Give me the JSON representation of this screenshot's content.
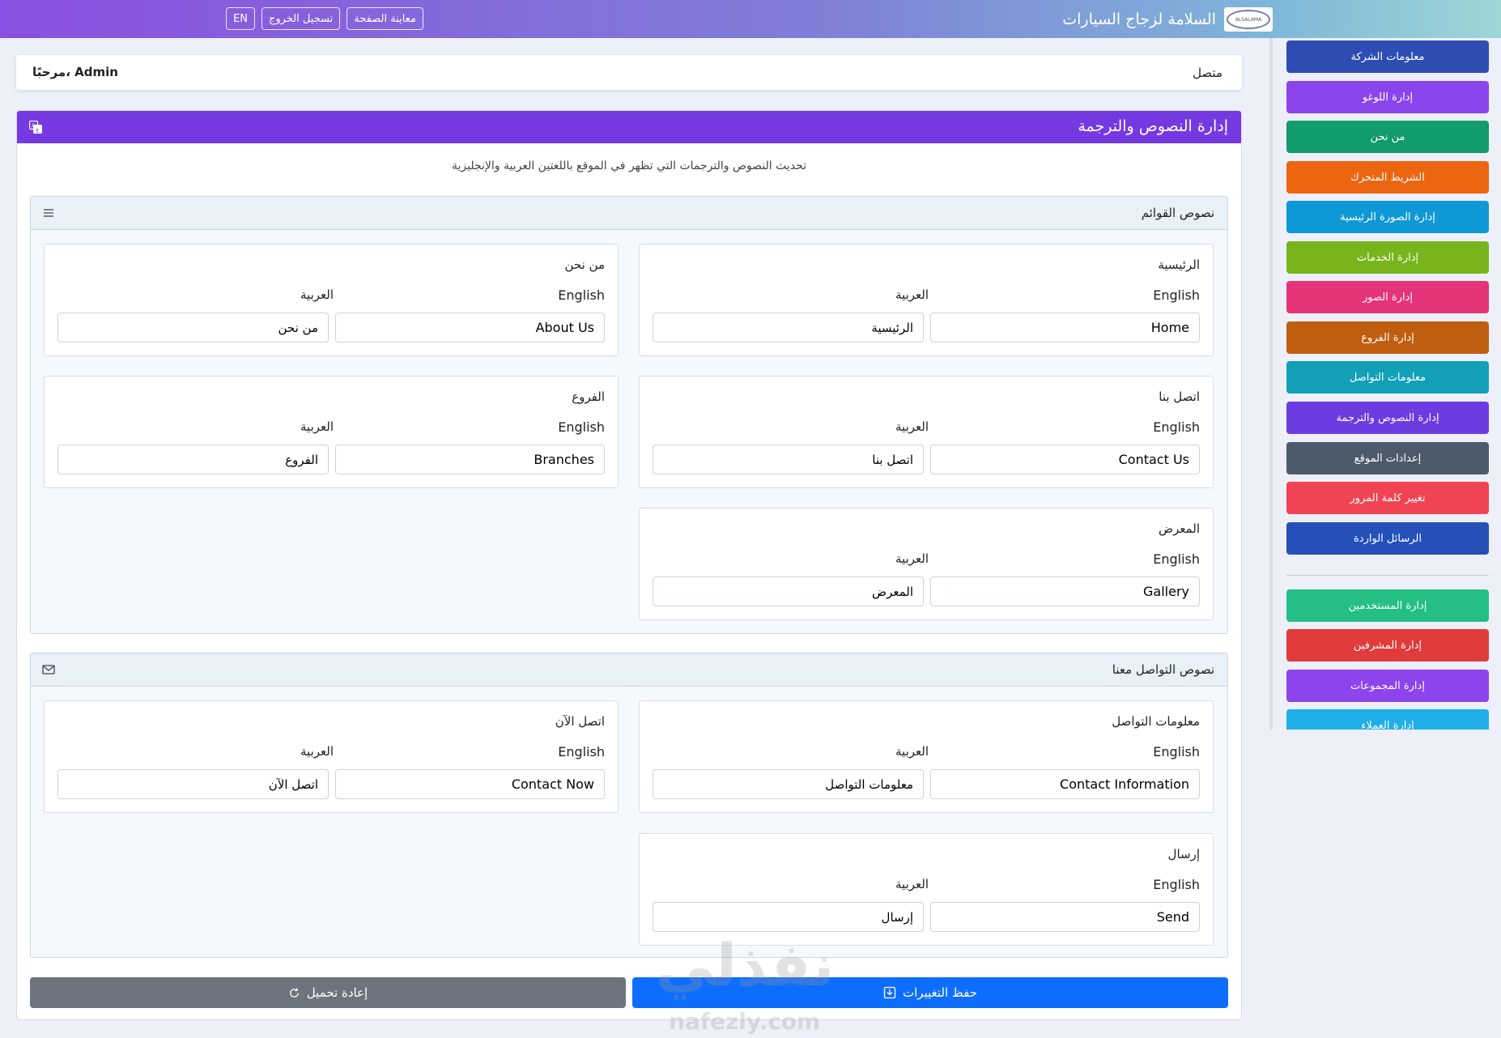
{
  "header": {
    "title": "السلامة لزجاج السيارات",
    "logo_text": "ALSALAMA",
    "buttons": {
      "preview": "معاينة الصفحة",
      "logout": "تسجيل الخروج",
      "lang": "EN"
    }
  },
  "welcome": {
    "status": "متصل",
    "greeting": "مرحبًا، Admin"
  },
  "panel": {
    "title": "إدارة النصوص والترجمة",
    "subtitle": "تحديث النصوص والترجمات التي تظهر في الموقع باللغتين العربية والإنجليزية",
    "labels": {
      "english": "English",
      "arabic": "العربية"
    },
    "sections": [
      {
        "title": "نصوص القوائم",
        "items": [
          {
            "title": "الرئيسية",
            "en": "Home",
            "ar": "الرئيسية"
          },
          {
            "title": "من نحن",
            "en": "About Us",
            "ar": "من نحن"
          },
          {
            "title": "اتصل بنا",
            "en": "Contact Us",
            "ar": "اتصل بنا"
          },
          {
            "title": "الفروع",
            "en": "Branches",
            "ar": "الفروع"
          },
          {
            "title": "المعرض",
            "en": "Gallery",
            "ar": "المعرض"
          }
        ]
      },
      {
        "title": "نصوص التواصل معنا",
        "items": [
          {
            "title": "معلومات التواصل",
            "en": "Contact Information",
            "ar": "معلومات التواصل"
          },
          {
            "title": "اتصل الآن",
            "en": "Contact Now",
            "ar": "اتصل الآن"
          },
          {
            "title": "إرسال",
            "en": "Send",
            "ar": "إرسال"
          }
        ]
      }
    ],
    "save_label": "حفظ التغييرات",
    "reload_label": "إعادة تحميل"
  },
  "sidebar": {
    "items": [
      {
        "label": "معلومات الشركة",
        "color": "#2d4db3"
      },
      {
        "label": "إدارة اللوغو",
        "color": "#8b44ec"
      },
      {
        "label": "من نحن",
        "color": "#129b6c"
      },
      {
        "label": "الشريط المتحرك",
        "color": "#ec6612"
      },
      {
        "label": "إدارة الصورة الرئيسية",
        "color": "#0f98d6"
      },
      {
        "label": "إدارة الخدمات",
        "color": "#78b51d"
      },
      {
        "label": "إدارة الصور",
        "color": "#e5347a"
      },
      {
        "label": "إدارة الفروع",
        "color": "#c05e10"
      },
      {
        "label": "معلومات التواصل",
        "color": "#11a0b8"
      },
      {
        "label": "إدارة النصوص والترجمة",
        "color": "#6c3ce0"
      },
      {
        "label": "إعدادات الموقع",
        "color": "#4d5a6c"
      },
      {
        "label": "تغيير كلمة المرور",
        "color": "#f04455"
      },
      {
        "label": "الرسائل الواردة",
        "color": "#2450b8"
      },
      {
        "label": "إدارة المستخدمين",
        "color": "#23bf84"
      },
      {
        "label": "إدارة المشرفين",
        "color": "#e03a3a"
      },
      {
        "label": "إدارة المجموعات",
        "color": "#8d44ec"
      },
      {
        "label": "إدارة العملاء",
        "color": "#1eaee8"
      }
    ]
  },
  "watermark": {
    "ar": "نفذلي",
    "en": "nafezly.com"
  }
}
